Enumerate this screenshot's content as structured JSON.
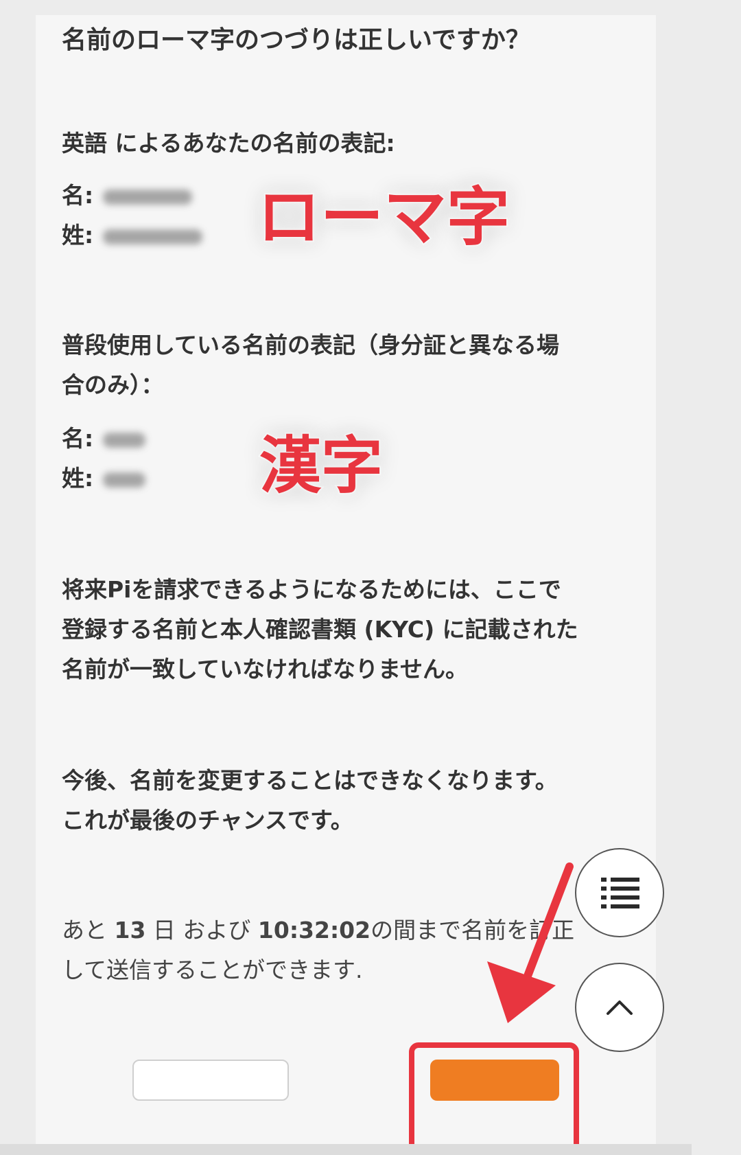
{
  "question": "名前のローマ字のつづりは正しいですか？",
  "english_section": {
    "heading": "英語 によるあなたの名前の表記:",
    "first_name_label": "名:",
    "last_name_label": "姓:"
  },
  "annotation_romaji": "ローマ字",
  "usual_section": {
    "heading_line1": "普段使用している名前の表記（身分証と異なる場",
    "heading_line2": "合のみ）：",
    "first_name_label": "名:",
    "last_name_label": "姓:"
  },
  "annotation_kanji": "漢字",
  "kyc_notice": {
    "line1": "将来Piを請求できるようになるためには、ここで",
    "line2": "登録する名前と本人確認書類 (KYC) に記載された",
    "line3": "名前が一致していなければなりません。"
  },
  "warning": {
    "line1": "今後、名前を変更することはできなくなります。",
    "line2": "これが最後のチャンスです。"
  },
  "deadline": {
    "prefix": "あと ",
    "days": "13",
    "days_unit": " 日 および ",
    "time": "10:32:02",
    "suffix": "の間まで名前を訂正",
    "line2": "して送信することができます."
  },
  "colors": {
    "annotation_red": "#e8353f",
    "submit_orange": "#ef7d22"
  },
  "icons": {
    "toc": "list-icon",
    "scroll_top": "chevron-up-icon"
  }
}
